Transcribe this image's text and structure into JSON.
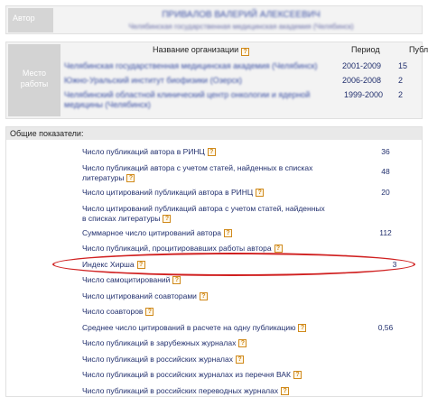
{
  "author": {
    "label": "Автор",
    "name": "ПРИВАЛОВ ВАЛЕРИЙ АЛЕКСЕЕВИЧ",
    "organization": "Челябинская государственная медицинская академия (Челябинск)"
  },
  "workplaces": {
    "label_line1": "Место",
    "label_line2": "работы",
    "header": {
      "org": "Название организации",
      "period": "Период",
      "pubs": "Публ."
    },
    "rows": [
      {
        "org": "Челябинская государственная медицинская академия (Челябинск)",
        "period": "2001-2009",
        "pubs": "15"
      },
      {
        "org": "Южно-Уральский институт биофизики (Озерск)",
        "period": "2006-2008",
        "pubs": "2"
      },
      {
        "org": "Челябинский областной клинический центр онкологии и ядерной медицины (Челябинск)",
        "period": "1999-2000",
        "pubs": "2"
      }
    ]
  },
  "general": {
    "title": "Общие показатели:",
    "items": [
      {
        "label": "Число публикаций автора в РИНЦ",
        "value": "36",
        "help": true
      },
      {
        "label": "Число публикаций автора с учетом статей, найденных в списках литературы",
        "value": "48",
        "help": true
      },
      {
        "label": "Число цитирований публикаций автора в РИНЦ",
        "value": "20",
        "help": true
      },
      {
        "label": "Число цитирований публикаций автора с учетом статей, найденных в списках литературы",
        "value": "",
        "help": true
      },
      {
        "label": "Суммарное число цитирований автора",
        "value": "112",
        "help": true
      },
      {
        "label": "Число публикаций, процитировавших работы автора",
        "value": "",
        "help": true
      },
      {
        "label": "Индекс Хирша",
        "value": "3",
        "help": true
      },
      {
        "label": "Число самоцитирований",
        "value": "",
        "help": true
      },
      {
        "label": "Число цитирований соавторами",
        "value": "",
        "help": true
      },
      {
        "label": "Число соавторов",
        "value": "",
        "help": true
      },
      {
        "label": "Среднее число цитирований в расчете на одну публикацию",
        "value": "0,56",
        "help": true
      },
      {
        "label": "Число публикаций в зарубежных журналах",
        "value": "",
        "help": true
      },
      {
        "label": "Число публикаций в российских журналах",
        "value": "",
        "help": true
      },
      {
        "label": "Число публикаций в российских журналах из перечня ВАК",
        "value": "",
        "help": true
      },
      {
        "label": "Число публикаций в российских переводных журналах",
        "value": "",
        "help": true
      }
    ]
  },
  "help_glyph": "?",
  "icons": {
    "help": "question-help-icon"
  },
  "colors": {
    "link": "#22306e",
    "highlight": "#d02020",
    "help": "#d08a1c"
  }
}
